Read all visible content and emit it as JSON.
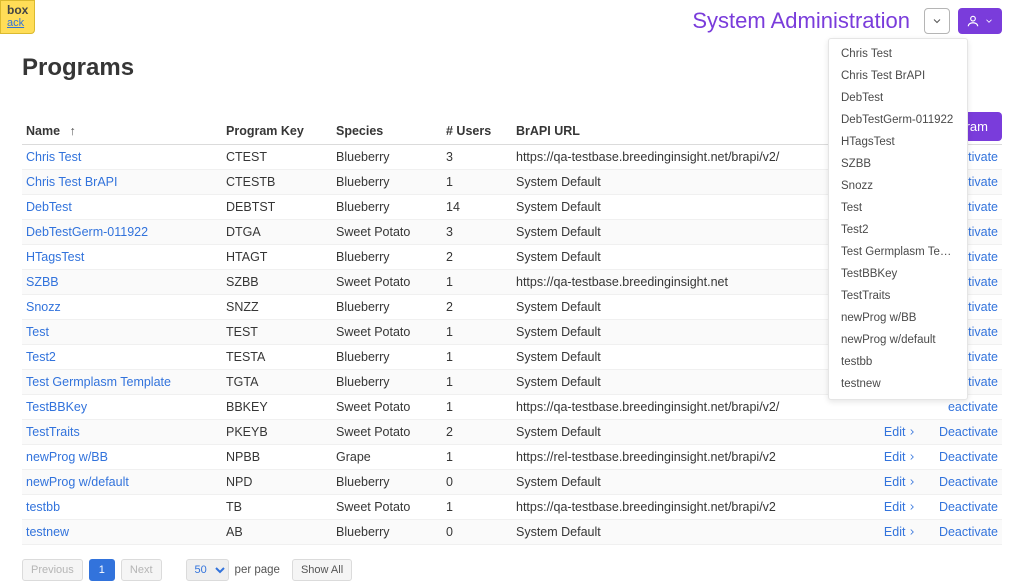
{
  "sandbox": {
    "line1": "box",
    "line2": "ack"
  },
  "header": {
    "title": "System Administration"
  },
  "new_program_btn": "ogram",
  "page_title": "Programs",
  "columns": {
    "name": "Name",
    "key": "Program Key",
    "species": "Species",
    "users": "# Users",
    "url": "BrAPI URL"
  },
  "actions": {
    "edit": "Edit",
    "deactivate": "Deactivate",
    "deactivate_truncated": "eactivate"
  },
  "sort_arrow": "↑",
  "rows": [
    {
      "name": "Chris Test",
      "key": "CTEST",
      "species": "Blueberry",
      "users": "3",
      "url": "https://qa-testbase.breedinginsight.net/brapi/v2/"
    },
    {
      "name": "Chris Test BrAPI",
      "key": "CTESTB",
      "species": "Blueberry",
      "users": "1",
      "url": "System Default"
    },
    {
      "name": "DebTest",
      "key": "DEBTST",
      "species": "Blueberry",
      "users": "14",
      "url": "System Default"
    },
    {
      "name": "DebTestGerm-011922",
      "key": "DTGA",
      "species": "Sweet Potato",
      "users": "3",
      "url": "System Default"
    },
    {
      "name": "HTagsTest",
      "key": "HTAGT",
      "species": "Blueberry",
      "users": "2",
      "url": "System Default"
    },
    {
      "name": "SZBB",
      "key": "SZBB",
      "species": "Sweet Potato",
      "users": "1",
      "url": "https://qa-testbase.breedinginsight.net"
    },
    {
      "name": "Snozz",
      "key": "SNZZ",
      "species": "Blueberry",
      "users": "2",
      "url": "System Default"
    },
    {
      "name": "Test",
      "key": "TEST",
      "species": "Sweet Potato",
      "users": "1",
      "url": "System Default"
    },
    {
      "name": "Test2",
      "key": "TESTA",
      "species": "Blueberry",
      "users": "1",
      "url": "System Default"
    },
    {
      "name": "Test Germplasm Template",
      "key": "TGTA",
      "species": "Blueberry",
      "users": "1",
      "url": "System Default"
    },
    {
      "name": "TestBBKey",
      "key": "BBKEY",
      "species": "Sweet Potato",
      "users": "1",
      "url": "https://qa-testbase.breedinginsight.net/brapi/v2/"
    },
    {
      "name": "TestTraits",
      "key": "PKEYB",
      "species": "Sweet Potato",
      "users": "2",
      "url": "System Default"
    },
    {
      "name": "newProg w/BB",
      "key": "NPBB",
      "species": "Grape",
      "users": "1",
      "url": "https://rel-testbase.breedinginsight.net/brapi/v2"
    },
    {
      "name": "newProg w/default",
      "key": "NPD",
      "species": "Blueberry",
      "users": "0",
      "url": "System Default"
    },
    {
      "name": "testbb",
      "key": "TB",
      "species": "Sweet Potato",
      "users": "1",
      "url": "https://qa-testbase.breedinginsight.net/brapi/v2"
    },
    {
      "name": "testnew",
      "key": "AB",
      "species": "Blueberry",
      "users": "0",
      "url": "System Default"
    }
  ],
  "dropdown_items": [
    "Chris Test",
    "Chris Test BrAPI",
    "DebTest",
    "DebTestGerm-011922",
    "HTagsTest",
    "SZBB",
    "Snozz",
    "Test",
    "Test2",
    "Test Germplasm Template",
    "TestBBKey",
    "TestTraits",
    "newProg w/BB",
    "newProg w/default",
    "testbb",
    "testnew"
  ],
  "pagination": {
    "previous": "Previous",
    "current": "1",
    "next": "Next",
    "per_page_value": "50",
    "per_page_label": "per page",
    "show_all": "Show All"
  }
}
